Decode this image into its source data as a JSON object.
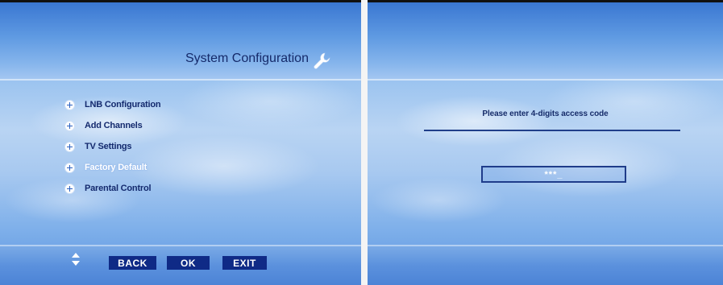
{
  "left_screen": {
    "title": "System Configuration",
    "title_icon": "wrench-icon",
    "menu": [
      {
        "label": "LNB Configuration",
        "selected": false
      },
      {
        "label": "Add Channels",
        "selected": false
      },
      {
        "label": "TV Settings",
        "selected": false
      },
      {
        "label": "Factory Default",
        "selected": true
      },
      {
        "label": "Parental Control",
        "selected": false
      }
    ],
    "footer": {
      "nav_icon": "up-down-arrows-icon",
      "back_label": "BACK",
      "ok_label": "OK",
      "exit_label": "EXIT"
    }
  },
  "right_screen": {
    "prompt": "Please enter 4-digits access code",
    "code_value": "***_"
  },
  "colors": {
    "button_bg": "#0f2a86",
    "text_dark": "#142a6e",
    "highlight_text": "#ffffff"
  }
}
